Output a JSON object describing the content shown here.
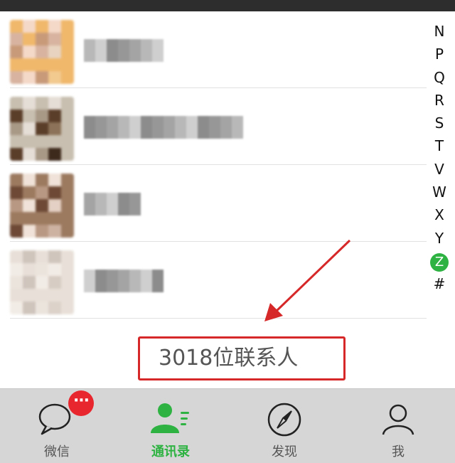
{
  "colors": {
    "accent": "#2eb342",
    "badge": "#e8262d",
    "annotation": "#d62828"
  },
  "contacts": [
    {
      "avatar_palette": [
        "#f0b86b",
        "#e8d3c0",
        "#d8b4a0",
        "#f4d8c8",
        "#c89a7a",
        "#f2c98e"
      ]
    },
    {
      "avatar_palette": [
        "#c8bfb0",
        "#8c7258",
        "#5b3e2a",
        "#e5ded6",
        "#a89886",
        "#3e2a1c"
      ]
    },
    {
      "avatar_palette": [
        "#9c7a60",
        "#e4d0c4",
        "#6e4a36",
        "#f0e2d8",
        "#b89882",
        "#cdb2a2"
      ]
    },
    {
      "avatar_palette": [
        "#e8e0d8",
        "#d6ccc4",
        "#f2ece6",
        "#cfc5bd",
        "#ebe4dd",
        "#dcd2ca"
      ]
    }
  ],
  "alpha_index": [
    "N",
    "P",
    "Q",
    "R",
    "S",
    "T",
    "V",
    "W",
    "X",
    "Y",
    "Z",
    "#"
  ],
  "alpha_active": "Z",
  "footer": {
    "contact_count": "3018位联系人"
  },
  "tabs": [
    {
      "label": "微信",
      "icon": "chat-bubble-icon",
      "badge": "···"
    },
    {
      "label": "通讯录",
      "icon": "contacts-icon",
      "active": true
    },
    {
      "label": "发现",
      "icon": "compass-icon"
    },
    {
      "label": "我",
      "icon": "profile-icon"
    }
  ]
}
